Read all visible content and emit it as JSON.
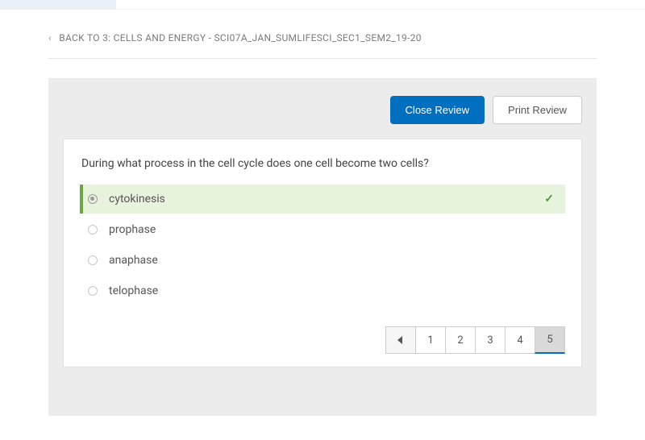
{
  "breadcrumb": {
    "label": "BACK TO 3: CELLS AND ENERGY - SCI07A_JAN_SUMLIFESCI_SEC1_SEM2_19-20"
  },
  "actions": {
    "close_label": "Close Review",
    "print_label": "Print Review"
  },
  "question": {
    "text": "During what process in the cell cycle does one cell become two cells?",
    "answers": [
      {
        "label": "cytokinesis",
        "correct": true,
        "selected": true
      },
      {
        "label": "prophase",
        "correct": false,
        "selected": false
      },
      {
        "label": "anaphase",
        "correct": false,
        "selected": false
      },
      {
        "label": "telophase",
        "correct": false,
        "selected": false
      }
    ]
  },
  "pagination": {
    "pages": [
      "1",
      "2",
      "3",
      "4",
      "5"
    ],
    "active": "5"
  }
}
